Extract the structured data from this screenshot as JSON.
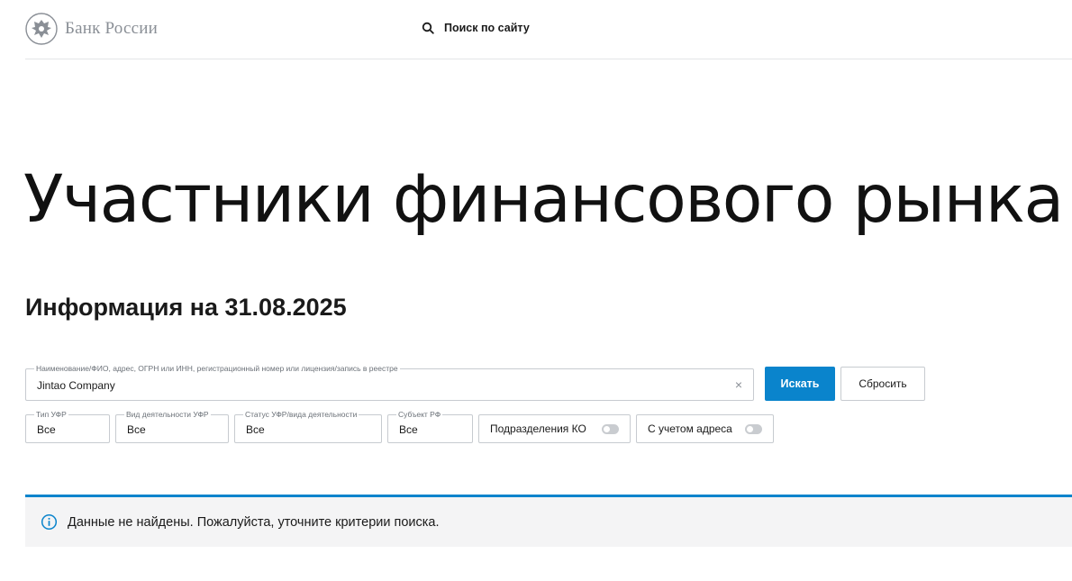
{
  "header": {
    "logo_text": "Банк России",
    "site_search_label": "Поиск по сайту"
  },
  "page": {
    "title": "Участники финансового рынка",
    "info_heading": "Информация на 31.08.2025"
  },
  "search": {
    "legend": "Наименование/ФИО, адрес, ОГРН или ИНН, регистрационный номер или лицензия/запись в реестре",
    "value": "Jintao Company",
    "clear_glyph": "×",
    "submit_label": "Искать",
    "reset_label": "Сбросить"
  },
  "filters": [
    {
      "legend": "Тип УФР",
      "value": "Все"
    },
    {
      "legend": "Вид деятельности УФР",
      "value": "Все"
    },
    {
      "legend": "Статус УФР/вида деятельности",
      "value": "Все"
    },
    {
      "legend": "Субъект РФ",
      "value": "Все"
    }
  ],
  "toggles": [
    {
      "label": "Подразделения КО",
      "on": false
    },
    {
      "label": "С учетом адреса",
      "on": false
    }
  ],
  "alert": {
    "text": "Данные не найдены. Пожалуйста, уточните критерии поиска."
  },
  "colors": {
    "accent": "#0a84cc",
    "alert_bg": "#f4f4f5",
    "logo_gray": "#8a8f96"
  },
  "icons": {
    "logo": "double-headed-eagle-icon",
    "site_search": "search-icon",
    "clear": "close-icon",
    "alert": "info-icon"
  }
}
